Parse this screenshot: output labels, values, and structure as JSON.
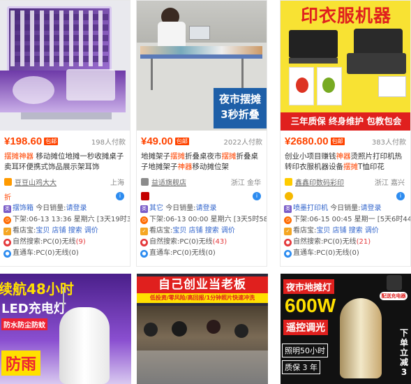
{
  "cards": [
    {
      "price": "¥198.60",
      "tag": "包邮",
      "sales": "198人付款",
      "title_pre": "",
      "title_hl": "摆摊神器",
      "title_post": " 移动摊位地摊一秒收摊桌子卖耳环便携式饰品展示架耳饰",
      "shop": "豆豆山鸡大大",
      "location": "上海",
      "badge": "折",
      "cat_label": "摆饰箱",
      "today_label": "今日销量:",
      "today_value": "请登录",
      "down_label": "下架:",
      "down_time": "06-13 13:36 星期六 [3天19时34分]",
      "view_label": "看店宝:",
      "view_links": "宝贝 店铺 搜索 调价",
      "natural_label": "自然搜索:",
      "natural_pc": "PC(0)",
      "natural_wx_label": "无线",
      "natural_wx": "(9)",
      "through_label": "直通车:",
      "through_pc": "PC(0)",
      "through_wx": "无线(0)"
    },
    {
      "price": "¥49.00",
      "tag": "包邮",
      "sales": "2022人付款",
      "title_pre": "地摊架子",
      "title_hl": "摆摊",
      "title_post": "折叠桌夜市",
      "title_hl2": "摆摊",
      "title_post2": "折叠桌子地摊架子",
      "title_hl3": "神器",
      "title_post3": "移动摊位架",
      "shop": "益适旗舰店",
      "location": "浙江 金华",
      "badge": "",
      "cat_label": "其它",
      "today_label": "今日销量:",
      "today_value": "请登录",
      "down_label": "下架:",
      "down_time": "06-13 00:00 星期六 [3天5时58分]",
      "view_label": "看店宝:",
      "view_links": "宝贝 店铺 搜索 调价",
      "natural_label": "自然搜索:",
      "natural_pc": "PC(0)",
      "natural_wx_label": "无线",
      "natural_wx": "(43)",
      "through_label": "直通车:",
      "through_pc": "PC(0)",
      "through_wx": "无线(0)"
    },
    {
      "price": "¥2680.00",
      "tag": "包邮",
      "sales": "383人付款",
      "title_pre": "创业小项目赚钱",
      "title_hl": "神器",
      "title_post": "烫照片打印机热转印衣服机器设备",
      "title_hl2": "摆摊",
      "title_post2": "T恤印花",
      "shop": "鑫鑫印数码彩印",
      "location": "浙江 嘉兴",
      "badge": "",
      "cat_label": "喷墨打印机",
      "today_label": "今日销量:",
      "today_value": "请登录",
      "down_label": "下架:",
      "down_time": "06-15 00:45 星期一 [5天6时44分]",
      "view_label": "看店宝:",
      "view_links": "宝贝 店铺 搜索 调价",
      "natural_label": "自然搜索:",
      "natural_pc": "PC(0)",
      "natural_wx_label": "无线",
      "natural_wx": "(21)",
      "through_label": "直通车:",
      "through_pc": "PC(0)",
      "through_wx": "无线(0)"
    }
  ],
  "banners": {
    "card2_title1": "夜市摆摊",
    "card2_title2": "3秒折叠",
    "card3_top": "印衣服机器",
    "card3_bottom": "三年质保 终身维护 包教包会",
    "b1_line1": "续航48小时",
    "b1_line2": "LED充电灯",
    "b1_line3": "防水防尘防蚊",
    "b1_line4": "防雨",
    "b2_line1": "自己创业当老板",
    "b2_line2": "低投资/零风险/高回报/1分钟照片快速冲洗",
    "b3_line1": "夜市地摊灯",
    "b3_line2": "600W",
    "b3_line3": "遥控调光",
    "b3_line4": "照明50小时",
    "b3_line5": "质保 3 年",
    "b3_side1": "下",
    "b3_side2": "单",
    "b3_side3": "立",
    "b3_side4": "减",
    "b3_side5": "3",
    "b3_badge": "配送充电器"
  },
  "colors": {
    "accent": "#ff4400",
    "link": "#3366cc",
    "bg": "#ffffff"
  }
}
